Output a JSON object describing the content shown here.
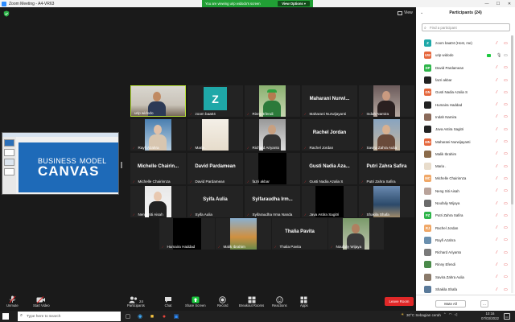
{
  "window": {
    "title": "Zoom Meeting - A4-VR63",
    "controls": [
      "—",
      "☐",
      "✕"
    ]
  },
  "banner": {
    "text": "You are viewing urip widodo's screen",
    "view_options": "View Options ▾"
  },
  "view_button": "View",
  "slide": {
    "line1": "BUSINESS",
    "model": "MODEL",
    "line2": "CANVAS"
  },
  "tiles": [
    {
      "name": "urip widodo",
      "kind": "photo",
      "active": true
    },
    {
      "name": "zoom baa04",
      "kind": "avatar",
      "avatar_letter": "Z"
    },
    {
      "name": "Rinny Efendi",
      "kind": "photo"
    },
    {
      "name": "Maharani Nurwijayanti",
      "kind": "text",
      "big": "Maharani Nurwi..."
    },
    {
      "name": "Indah Namira",
      "kind": "photo"
    },
    {
      "name": "Rayfi Azahra",
      "kind": "photo"
    },
    {
      "name": "Maria .",
      "kind": "photo"
    },
    {
      "name": "Richard Ariyanto",
      "kind": "photo"
    },
    {
      "name": "Rachel Jordan",
      "kind": "text",
      "big": "Rachel Jordan"
    },
    {
      "name": "Savira Zahra Aulia",
      "kind": "photo"
    },
    {
      "name": "Michelle Chairinnza",
      "kind": "text",
      "big": "Michelle Chairin..."
    },
    {
      "name": "David Pardamean",
      "kind": "text",
      "big": "David Pardamean"
    },
    {
      "name": "fazri akbar",
      "kind": "black"
    },
    {
      "name": "Gusti Nadia Azalia S",
      "kind": "text",
      "big": "Gusti Nadia Aza..."
    },
    {
      "name": "Putri Zahra Safira",
      "kind": "text",
      "big": "Putri Zahra Safira"
    },
    {
      "name": "Neng Siti Aisah",
      "kind": "photo"
    },
    {
      "name": "Syifa Aulia",
      "kind": "text",
      "big": "Syifa Aulia"
    },
    {
      "name": "Syifaraudha Irma Nanda",
      "kind": "text",
      "big": "Syifaraudha Irm..."
    },
    {
      "name": "Java Astira Sagitri",
      "kind": "black"
    },
    {
      "name": "Shakila Shafa",
      "kind": "photo"
    },
    {
      "name": "Humaira Haddad",
      "kind": "black"
    },
    {
      "name": "Malik Ibrahim",
      "kind": "photo"
    },
    {
      "name": "Thalia Pavita",
      "kind": "text",
      "big": "Thalia Pavita"
    },
    {
      "name": "Noufaliy Wijaya",
      "kind": "photo"
    }
  ],
  "toolbar": {
    "unmute": "Unmute",
    "start_video": "Start Video",
    "participants": "Participants",
    "participants_count": "24",
    "chat": "Chat",
    "share_screen": "Share Screen",
    "record": "Record",
    "breakout": "Breakout Rooms",
    "reactions": "Reactions",
    "apps": "Apps",
    "leave": "Leave Room"
  },
  "panel": {
    "title": "Participants (24)",
    "search_placeholder": "Find a participant",
    "mute_all": "Mute All",
    "more": "...",
    "participants": [
      {
        "name": "zoom baa04 (Host, me)",
        "initials": "Z",
        "color": "#1fa8a8",
        "mic_on": false
      },
      {
        "name": "urip widodo",
        "initials": "UW",
        "color": "#e5673c",
        "mic_on": true
      },
      {
        "name": "David Pardamean",
        "initials": "DP",
        "color": "#2eb54a",
        "mic_on": false
      },
      {
        "name": "fazri akbar",
        "initials": "",
        "color": "#222222",
        "mic_on": false
      },
      {
        "name": "Gusti Nadia Azalia S",
        "initials": "GN",
        "color": "#e5673c",
        "mic_on": false
      },
      {
        "name": "Humaira Haddad",
        "initials": "",
        "color": "#222222",
        "mic_on": false
      },
      {
        "name": "Indah Namira",
        "initials": "",
        "color": "#8a6a5a",
        "mic_on": false
      },
      {
        "name": "Java Astira Sagitri",
        "initials": "",
        "color": "#222222",
        "mic_on": false
      },
      {
        "name": "Maharani Nurwijayanti",
        "initials": "MN",
        "color": "#e5673c",
        "mic_on": false
      },
      {
        "name": "Malik Ibrahim",
        "initials": "",
        "color": "#8b6b4a",
        "mic_on": false
      },
      {
        "name": "Maria .",
        "initials": "",
        "color": "#e8dccb",
        "mic_on": false
      },
      {
        "name": "Michelle Chairinnza",
        "initials": "MC",
        "color": "#f0a868",
        "mic_on": false
      },
      {
        "name": "Neng Siti Aisah",
        "initials": "",
        "color": "#b9a39a",
        "mic_on": false
      },
      {
        "name": "Noufaliy Wijaya",
        "initials": "",
        "color": "#6a6a6a",
        "mic_on": false
      },
      {
        "name": "Putri Zahra Safira",
        "initials": "PZ",
        "color": "#2eb54a",
        "mic_on": false
      },
      {
        "name": "Rachel Jordan",
        "initials": "RJ",
        "color": "#f0a868",
        "mic_on": false
      },
      {
        "name": "Rayfi Azahra",
        "initials": "",
        "color": "#6a8fae",
        "mic_on": false
      },
      {
        "name": "Richard Ariyanto",
        "initials": "",
        "color": "#7a7a7a",
        "mic_on": false
      },
      {
        "name": "Rinny Efendi",
        "initials": "",
        "color": "#4a8a4a",
        "mic_on": false
      },
      {
        "name": "Savira Zahra Aulia",
        "initials": "",
        "color": "#8a7a6a",
        "mic_on": false
      },
      {
        "name": "Shakila Shafa",
        "initials": "",
        "color": "#5a7a9a",
        "mic_on": false
      }
    ]
  },
  "taskbar": {
    "search_placeholder": "Type here to search",
    "weather": "30°C  Sebagian cerah",
    "time": "10:16",
    "date": "07/03/2022"
  }
}
